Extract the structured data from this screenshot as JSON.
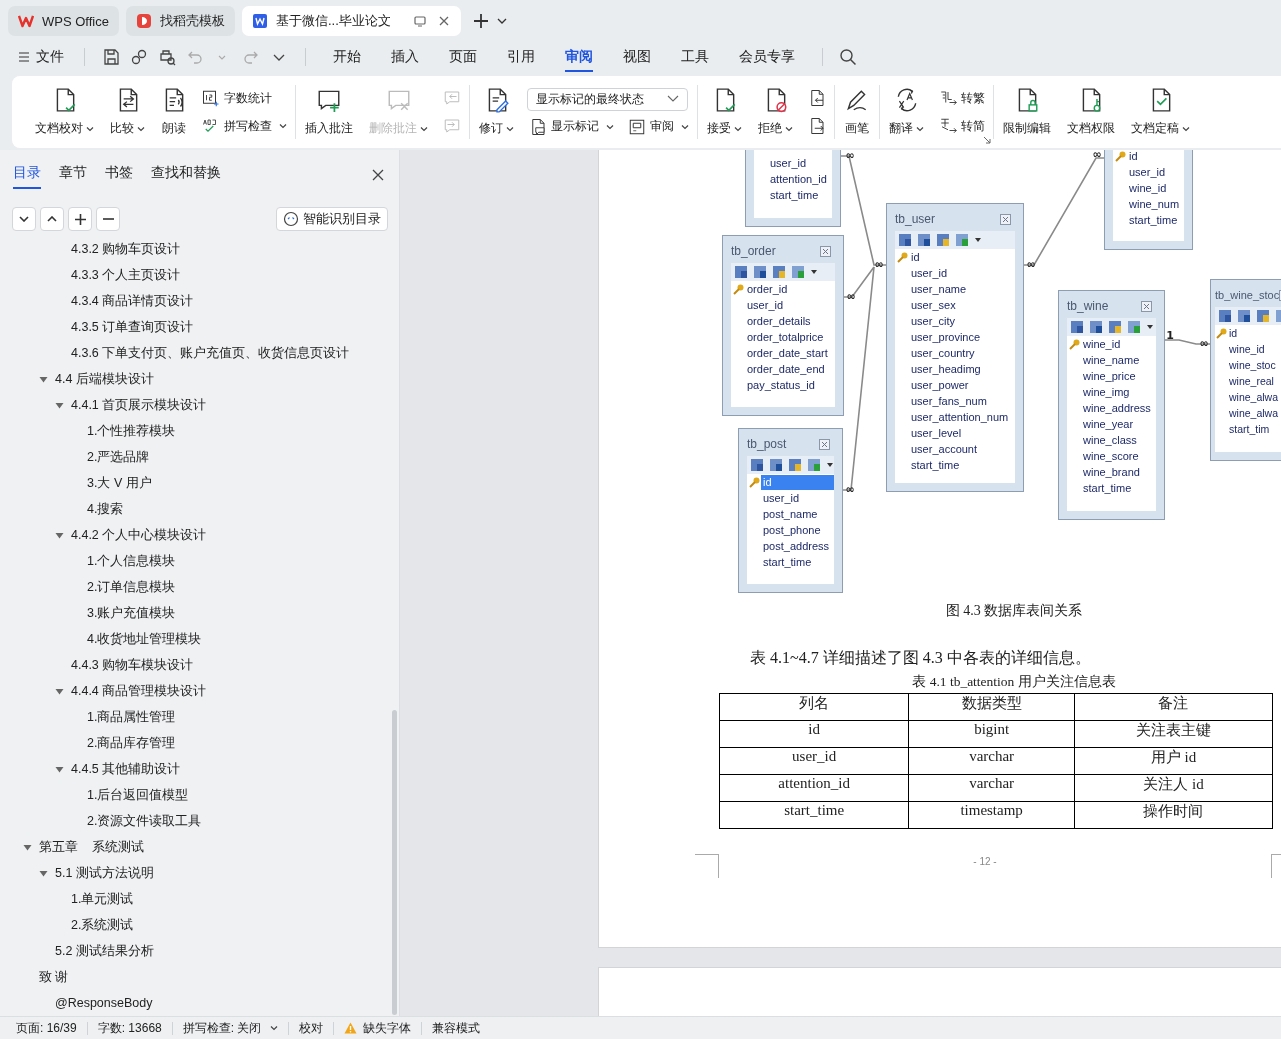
{
  "tabs": [
    {
      "label": "WPS Office",
      "kind": "wps",
      "selected": false
    },
    {
      "label": "找稻壳模板",
      "kind": "template",
      "selected": false
    },
    {
      "label": "基于微信...毕业论文",
      "kind": "doc",
      "selected": true
    }
  ],
  "menu": {
    "file_label": "文件",
    "items": [
      {
        "label": "开始",
        "selected": false
      },
      {
        "label": "插入",
        "selected": false
      },
      {
        "label": "页面",
        "selected": false
      },
      {
        "label": "引用",
        "selected": false
      },
      {
        "label": "审阅",
        "selected": true
      },
      {
        "label": "视图",
        "selected": false
      },
      {
        "label": "工具",
        "selected": false
      },
      {
        "label": "会员专享",
        "selected": false
      }
    ]
  },
  "ribbon": {
    "groups": [
      {
        "items": [
          {
            "kind": "big",
            "label": "文档校对",
            "caret": true,
            "disabled": false
          },
          {
            "kind": "big",
            "label": "比较",
            "caret": true,
            "disabled": false
          },
          {
            "kind": "big",
            "label": "朗读",
            "caret": false,
            "disabled": false
          },
          {
            "kind": "stack",
            "buttons": [
              {
                "label": "字数统计",
                "caret": false,
                "disabled": false
              },
              {
                "label": "拼写检查",
                "caret": true,
                "disabled": false
              }
            ]
          }
        ]
      },
      {
        "items": [
          {
            "kind": "big",
            "label": "插入批注",
            "caret": false,
            "disabled": false
          },
          {
            "kind": "big",
            "label": "删除批注",
            "caret": true,
            "disabled": true
          },
          {
            "kind": "stack",
            "buttons": [
              {
                "caret": false,
                "disabled": true
              },
              {
                "caret": false,
                "disabled": true
              }
            ]
          }
        ]
      },
      {
        "items": [
          {
            "kind": "big",
            "label": "修订",
            "caret": true,
            "disabled": false
          },
          {
            "kind": "panel",
            "field": "显示标记的最终状态",
            "buttons": [
              {
                "label": "显示标记",
                "caret": true,
                "disabled": false
              },
              {
                "label": "审阅",
                "caret": true,
                "disabled": false
              }
            ]
          }
        ]
      },
      {
        "items": [
          {
            "kind": "big",
            "label": "接受",
            "caret": true,
            "disabled": false
          },
          {
            "kind": "big",
            "label": "拒绝",
            "caret": true,
            "disabled": false
          },
          {
            "kind": "stack",
            "buttons": [
              {
                "caret": false,
                "disabled": false
              },
              {
                "caret": false,
                "disabled": false
              }
            ]
          }
        ]
      },
      {
        "items": [
          {
            "kind": "big",
            "label": "画笔",
            "caret": false,
            "disabled": false
          }
        ]
      },
      {
        "launcher": true,
        "items": [
          {
            "kind": "big",
            "label": "翻译",
            "caret": true,
            "disabled": false
          },
          {
            "kind": "stack",
            "buttons": [
              {
                "label": "转繁",
                "caret": false,
                "disabled": false
              },
              {
                "label": "转简",
                "caret": false,
                "disabled": false
              }
            ]
          }
        ]
      },
      {
        "items": [
          {
            "kind": "big",
            "label": "限制编辑",
            "caret": false,
            "disabled": false
          },
          {
            "kind": "big",
            "label": "文档权限",
            "caret": false,
            "disabled": false
          },
          {
            "kind": "big",
            "label": "文档定稿",
            "caret": true,
            "disabled": false
          }
        ]
      }
    ]
  },
  "nav_panel": {
    "tabs": [
      {
        "label": "目录",
        "selected": true
      },
      {
        "label": "章节",
        "selected": false
      },
      {
        "label": "书签",
        "selected": false
      },
      {
        "label": "查找和替换",
        "selected": false
      }
    ],
    "smart_button": "智能识别目录",
    "toc": [
      {
        "children": [
          {
            "children": [
              {
                "label": "4.3.2 购物车页设计"
              },
              {
                "label": "4.3.3 个人主页设计"
              },
              {
                "label": "4.3.4 商品详情页设计"
              },
              {
                "label": "4.3.5 订单查询页设计"
              },
              {
                "label": "4.3.6 下单支付页、账户充值页、收货信息页设计"
              }
            ]
          },
          {
            "label": "4.4 后端模块设计",
            "expanded": true,
            "children": [
              {
                "label": "4.4.1 首页展示模块设计",
                "expanded": true,
                "children": [
                  {
                    "label": "1.个性推荐模块"
                  },
                  {
                    "label": "2.严选品牌"
                  },
                  {
                    "label": "3.大 V 用户"
                  },
                  {
                    "label": "4.搜索"
                  }
                ]
              },
              {
                "label": "4.4.2 个人中心模块设计",
                "expanded": true,
                "children": [
                  {
                    "label": "1.个人信息模块"
                  },
                  {
                    "label": "2.订单信息模块"
                  },
                  {
                    "label": "3.账户充值模块"
                  },
                  {
                    "label": "4.收货地址管理模块"
                  }
                ]
              },
              {
                "label": "4.4.3 购物车模块设计"
              },
              {
                "label": "4.4.4 商品管理模块设计",
                "expanded": true,
                "children": [
                  {
                    "label": "1.商品属性管理"
                  },
                  {
                    "label": "2.商品库存管理"
                  }
                ]
              },
              {
                "label": "4.4.5 其他辅助设计",
                "expanded": true,
                "children": [
                  {
                    "label": "1.后台返回值模型"
                  },
                  {
                    "label": "2.资源文件读取工具"
                  }
                ]
              }
            ]
          }
        ]
      },
      {
        "label": "第五章    系统测试",
        "expanded": true,
        "children": [
          {
            "label": "5.1 测试方法说明",
            "expanded": true,
            "children": [
              {
                "label": "1.单元测试"
              },
              {
                "label": "2.系统测试"
              }
            ]
          },
          {
            "label": "5.2 测试结果分析"
          }
        ]
      },
      {
        "label": "致 谢"
      },
      {
        "children": [
          {
            "label": "@ResponseBody"
          }
        ]
      }
    ]
  },
  "document": {
    "diagram": {
      "tables": [
        {
          "fields": [
            {
              "name": "user_id",
              "key": false,
              "selected": false
            },
            {
              "name": "attention_id",
              "key": false,
              "selected": false
            },
            {
              "name": "start_time",
              "key": false,
              "selected": false
            }
          ]
        },
        {
          "title": "tb_order",
          "fields": [
            {
              "name": "order_id",
              "key": true,
              "selected": false
            },
            {
              "name": "user_id",
              "key": false,
              "selected": false
            },
            {
              "name": "order_details",
              "key": false,
              "selected": false
            },
            {
              "name": "order_totalprice",
              "key": false,
              "selected": false
            },
            {
              "name": "order_date_start",
              "key": false,
              "selected": false
            },
            {
              "name": "order_date_end",
              "key": false,
              "selected": false
            },
            {
              "name": "pay_status_id",
              "key": false,
              "selected": false
            }
          ]
        },
        {
          "title": "tb_post",
          "fields": [
            {
              "name": "id",
              "key": true,
              "selected": true
            },
            {
              "name": "user_id",
              "key": false,
              "selected": false
            },
            {
              "name": "post_name",
              "key": false,
              "selected": false
            },
            {
              "name": "post_phone",
              "key": false,
              "selected": false
            },
            {
              "name": "post_address",
              "key": false,
              "selected": false
            },
            {
              "name": "start_time",
              "key": false,
              "selected": false
            }
          ]
        },
        {
          "title": "tb_user",
          "fields": [
            {
              "name": "id",
              "key": true,
              "selected": false
            },
            {
              "name": "user_id",
              "key": false,
              "selected": false
            },
            {
              "name": "user_name",
              "key": false,
              "selected": false
            },
            {
              "name": "user_sex",
              "key": false,
              "selected": false
            },
            {
              "name": "user_city",
              "key": false,
              "selected": false
            },
            {
              "name": "user_province",
              "key": false,
              "selected": false
            },
            {
              "name": "user_country",
              "key": false,
              "selected": false
            },
            {
              "name": "user_headimg",
              "key": false,
              "selected": false
            },
            {
              "name": "user_power",
              "key": false,
              "selected": false
            },
            {
              "name": "user_fans_num",
              "key": false,
              "selected": false
            },
            {
              "name": "user_attention_num",
              "key": false,
              "selected": false
            },
            {
              "name": "user_level",
              "key": false,
              "selected": false
            },
            {
              "name": "user_account",
              "key": false,
              "selected": false
            },
            {
              "name": "start_time",
              "key": false,
              "selected": false
            }
          ]
        },
        {
          "fields": [
            {
              "name": "id",
              "key": true,
              "selected": false
            },
            {
              "name": "user_id",
              "key": false,
              "selected": false
            },
            {
              "name": "wine_id",
              "key": false,
              "selected": false
            },
            {
              "name": "wine_num",
              "key": false,
              "selected": false
            },
            {
              "name": "start_time",
              "key": false,
              "selected": false
            }
          ]
        },
        {
          "title": "tb_wine",
          "fields": [
            {
              "name": "wine_id",
              "key": true,
              "selected": false
            },
            {
              "name": "wine_name",
              "key": false,
              "selected": false
            },
            {
              "name": "wine_price",
              "key": false,
              "selected": false
            },
            {
              "name": "wine_img",
              "key": false,
              "selected": false
            },
            {
              "name": "wine_address",
              "key": false,
              "selected": false
            },
            {
              "name": "wine_year",
              "key": false,
              "selected": false
            },
            {
              "name": "wine_class",
              "key": false,
              "selected": false
            },
            {
              "name": "wine_score",
              "key": false,
              "selected": false
            },
            {
              "name": "wine_brand",
              "key": false,
              "selected": false
            },
            {
              "name": "start_time",
              "key": false,
              "selected": false
            }
          ]
        },
        {
          "title": "tb_wine_stoc",
          "fields": [
            {
              "name": "id",
              "key": true,
              "selected": false
            },
            {
              "name": "wine_id",
              "key": false,
              "selected": false
            },
            {
              "name": "wine_stoc",
              "key": false,
              "selected": false
            },
            {
              "name": "wine_real",
              "key": false,
              "selected": false
            },
            {
              "name": "wine_alwa",
              "key": false,
              "selected": false
            },
            {
              "name": "wine_alwa",
              "key": false,
              "selected": false
            },
            {
              "name": "start_tim",
              "key": false,
              "selected": false
            }
          ]
        }
      ],
      "relations": [
        {
          "from": "∞",
          "to": "∞"
        },
        {
          "from": "∞"
        },
        {
          "from": "∞"
        },
        {
          "from": "∞",
          "to": "∞"
        },
        {
          "from": "1",
          "to": "∞"
        }
      ]
    },
    "caption": "图 4.3 数据库表间关系",
    "paragraph": "表 4.1~4.7 详细描述了图 4.3 中各表的详细信息。",
    "table_caption": "表 4.1 tb_attention 用户关注信息表",
    "table": {
      "columns": [
        "列名",
        "数据类型",
        "备注"
      ],
      "rows": [
        [
          "id",
          "bigint",
          "关注表主键"
        ],
        [
          "user_id",
          "varchar",
          "用户 id"
        ],
        [
          "attention_id",
          "varchar",
          "关注人 id"
        ],
        [
          "start_time",
          "timestamp",
          "操作时间"
        ]
      ]
    },
    "page_number": "- 12 -"
  },
  "status_bar": [
    {
      "kind": "text",
      "label": "页面: 16/39"
    },
    {
      "kind": "text",
      "label": "字数: 13668"
    },
    {
      "kind": "dropdown",
      "label": "拼写检查: 关闭"
    },
    {
      "kind": "text",
      "label": "校对"
    },
    {
      "kind": "warning",
      "label": "缺失字体"
    },
    {
      "kind": "text",
      "label": "兼容模式"
    }
  ]
}
